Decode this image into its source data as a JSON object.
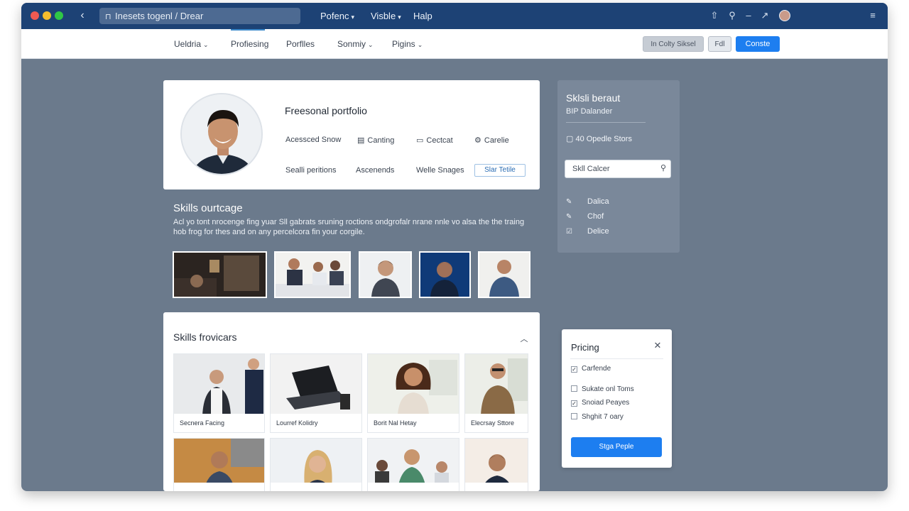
{
  "titlebar": {
    "address": "Inesets togenl / Drear",
    "menus": [
      {
        "label": "Pofenc",
        "dropdown": true
      },
      {
        "label": "Visble",
        "dropdown": true
      },
      {
        "label": "Halp",
        "dropdown": false
      }
    ],
    "icons": [
      "share-icon",
      "search-icon",
      "minus-icon",
      "arrow-icon",
      "user-avatar",
      "hamburger-icon"
    ]
  },
  "nav": {
    "items": [
      {
        "label": "Ueldria",
        "dropdown": true
      },
      {
        "label": "Profiesing",
        "dropdown": false,
        "active": true
      },
      {
        "label": "Porflles",
        "dropdown": false
      },
      {
        "label": "Sonmiy",
        "dropdown": true
      },
      {
        "label": "Pigins",
        "dropdown": true
      }
    ],
    "buttons": [
      "In Colty Siksel",
      "Fdl",
      "Conste"
    ]
  },
  "profile": {
    "title": "Freesonal portfolio",
    "actions": [
      {
        "label": "Acessced Snow",
        "icon": ""
      },
      {
        "label": "Canting",
        "icon": "document-icon"
      },
      {
        "label": "Cectcat",
        "icon": "card-icon"
      },
      {
        "label": "Carelie",
        "icon": "gear-icon"
      }
    ],
    "links": [
      "Sealli peritions",
      "Ascenends",
      "Welle Snages"
    ],
    "button": "Slar Tetile"
  },
  "overview": {
    "heading": "Skills ourtcage",
    "description": "Acl yo tont nrocenge fing yuar Sll gabrats sruning roctions ondgrofalr nrane nnle vo alsa the the traing hob frog for thes and on any percelcora fin your corgile."
  },
  "showcase": {
    "heading": "Skills frovicars",
    "tiles": [
      {
        "caption": "Secnera Facing"
      },
      {
        "caption": "Lourref Kolidry"
      },
      {
        "caption": "Borit Nal Hetay"
      },
      {
        "caption": "Elecrsay Sttore"
      },
      {
        "caption": ""
      },
      {
        "caption": ""
      },
      {
        "caption": ""
      },
      {
        "caption": ""
      }
    ]
  },
  "sidepanel": {
    "title": "Sklsli beraut",
    "subtitle": "BIP Dalander",
    "count": "40 Opedle Stors",
    "search_value": "Skll Calcer",
    "items": [
      "Dalica",
      "Chof",
      "Delice"
    ]
  },
  "pricing": {
    "title": "Pricing",
    "options": [
      {
        "label": "Carfende",
        "checked": true
      },
      {
        "label": "Sukate onl Toms",
        "checked": false
      },
      {
        "label": "Snoiad Peayes",
        "checked": true
      },
      {
        "label": "Shghit 7 oary",
        "checked": false
      }
    ],
    "button": "Stga Peple"
  },
  "colors": {
    "titlebar": "#1d4275",
    "canvas": "#6b7a8c",
    "accent": "#1d7ef0"
  }
}
